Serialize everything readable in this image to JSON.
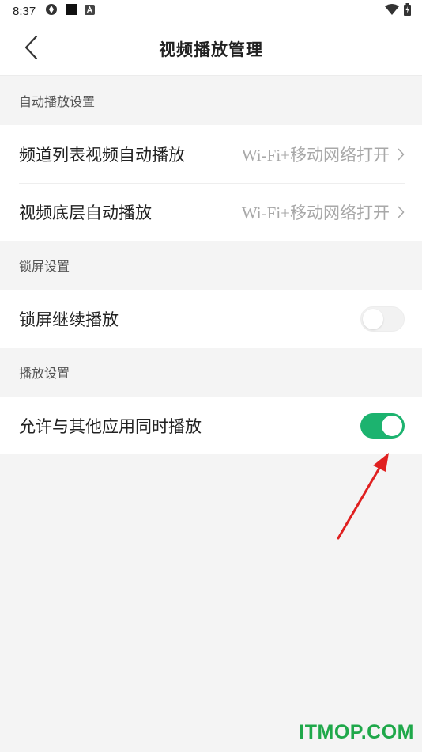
{
  "status_bar": {
    "time": "8:37",
    "icons": [
      "app-shutter-icon",
      "stop-square-icon",
      "font-a-icon",
      "wifi-icon",
      "battery-charging-icon"
    ]
  },
  "nav": {
    "title": "视频播放管理",
    "back_icon": "chevron-left-icon"
  },
  "sections": {
    "autoplay": {
      "header": "自动播放设置",
      "rows": [
        {
          "label": "频道列表视频自动播放",
          "value": "Wi-Fi+移动网络打开"
        },
        {
          "label": "视频底层自动播放",
          "value": "Wi-Fi+移动网络打开"
        }
      ]
    },
    "lockscreen": {
      "header": "锁屏设置",
      "rows": [
        {
          "label": "锁屏继续播放",
          "toggle": false
        }
      ]
    },
    "playback": {
      "header": "播放设置",
      "rows": [
        {
          "label": "允许与其他应用同时播放",
          "toggle": true
        }
      ]
    }
  },
  "colors": {
    "accent_green": "#1cb36f",
    "annotation_red": "#e02020",
    "watermark_green": "#1fa84a"
  },
  "watermark": "ITMOP.COM"
}
